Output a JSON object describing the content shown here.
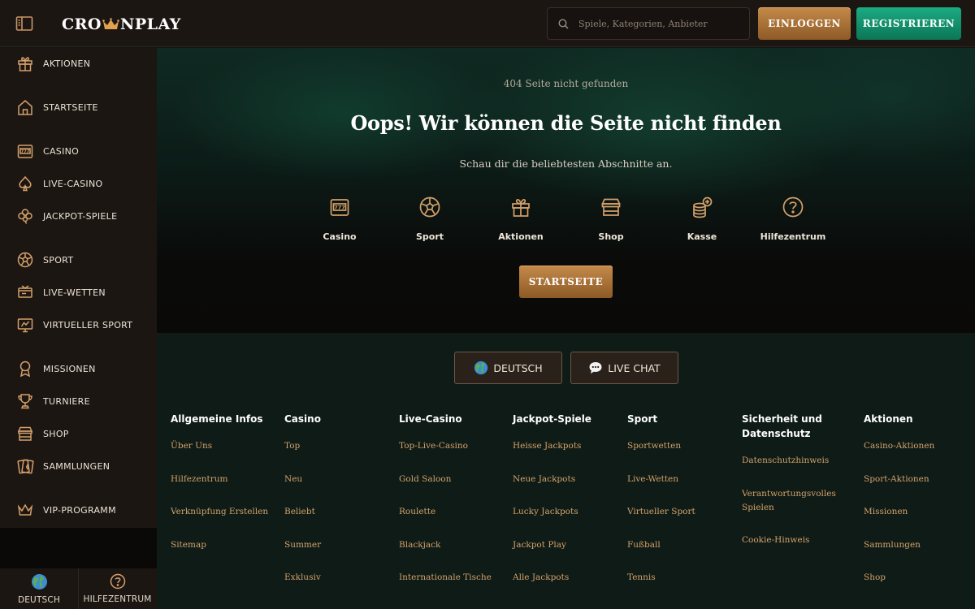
{
  "brand": {
    "logo_left": "CRO",
    "logo_right": "NPLAY"
  },
  "header": {
    "search_placeholder": "Spiele, Kategorien, Anbieter",
    "login_label": "EINLOGGEN",
    "register_label": "REGISTRIEREN"
  },
  "sidebar": {
    "items": [
      {
        "label": "AKTIONEN",
        "icon": "gift-icon"
      },
      {
        "label": "STARTSEITE",
        "icon": "home-icon"
      },
      {
        "label": "CASINO",
        "icon": "slot-machine-icon"
      },
      {
        "label": "LIVE-CASINO",
        "icon": "spade-icon"
      },
      {
        "label": "JACKPOT-SPIELE",
        "icon": "clover-icon"
      },
      {
        "label": "SPORT",
        "icon": "soccer-ball-icon"
      },
      {
        "label": "LIVE-WETTEN",
        "icon": "live-ticket-icon"
      },
      {
        "label": "VIRTUELLER SPORT",
        "icon": "monitor-icon"
      },
      {
        "label": "MISSIONEN",
        "icon": "medal-icon"
      },
      {
        "label": "TURNIERE",
        "icon": "trophy-icon"
      },
      {
        "label": "SHOP",
        "icon": "shop-icon"
      },
      {
        "label": "SAMMLUNGEN",
        "icon": "cards-icon"
      },
      {
        "label": "VIP-PROGRAMM",
        "icon": "crown-icon"
      }
    ],
    "bottom_language": "DEUTSCH",
    "bottom_help": "HILFEZENTRUM"
  },
  "hero": {
    "subtitle": "404 Seite nicht gefunden",
    "title": "Oops! Wir können die Seite nicht finden",
    "description": "Schau dir die beliebtesten Abschnitte an.",
    "quick_links": [
      {
        "label": "Casino",
        "icon": "slot-machine-icon"
      },
      {
        "label": "Sport",
        "icon": "soccer-ball-icon"
      },
      {
        "label": "Aktionen",
        "icon": "gift-icon"
      },
      {
        "label": "Shop",
        "icon": "shop-icon"
      },
      {
        "label": "Kasse",
        "icon": "coins-icon"
      },
      {
        "label": "Hilfezentrum",
        "icon": "help-icon"
      }
    ],
    "home_button": "STARTSEITE"
  },
  "footer": {
    "language_button": "DEUTSCH",
    "chat_button": "LIVE CHAT",
    "columns": [
      {
        "title": "Allgemeine Infos",
        "links": [
          "Über Uns",
          "Hilfezentrum",
          "Verknüpfung Erstellen",
          "Sitemap"
        ]
      },
      {
        "title": "Casino",
        "links": [
          "Top",
          "Neu",
          "Beliebt",
          "Summer",
          "Exklusiv"
        ]
      },
      {
        "title": "Live-Casino",
        "links": [
          "Top-Live-Casino",
          "Gold Saloon",
          "Roulette",
          "Blackjack",
          "Internationale Tische"
        ]
      },
      {
        "title": "Jackpot-Spiele",
        "links": [
          "Heisse Jackpots",
          "Neue Jackpots",
          "Lucky Jackpots",
          "Jackpot Play",
          "Alle Jackpots"
        ]
      },
      {
        "title": "Sport",
        "links": [
          "Sportwetten",
          "Live-Wetten",
          "Virtueller Sport",
          "Fußball",
          "Tennis"
        ]
      },
      {
        "title": "Sicherheit und Datenschutz",
        "links": [
          "Datenschutzhinweis",
          "Verantwortungsvolles Spielen",
          "Cookie-Hinweis"
        ]
      },
      {
        "title": "Aktionen",
        "links": [
          "Casino-Aktionen",
          "Sport-Aktionen",
          "Missionen",
          "Sammlungen",
          "Shop"
        ]
      }
    ]
  },
  "colors": {
    "gold": "#c48a4a",
    "green": "#1bab83",
    "link": "#d2a26a",
    "icon": "#d4a06a"
  }
}
